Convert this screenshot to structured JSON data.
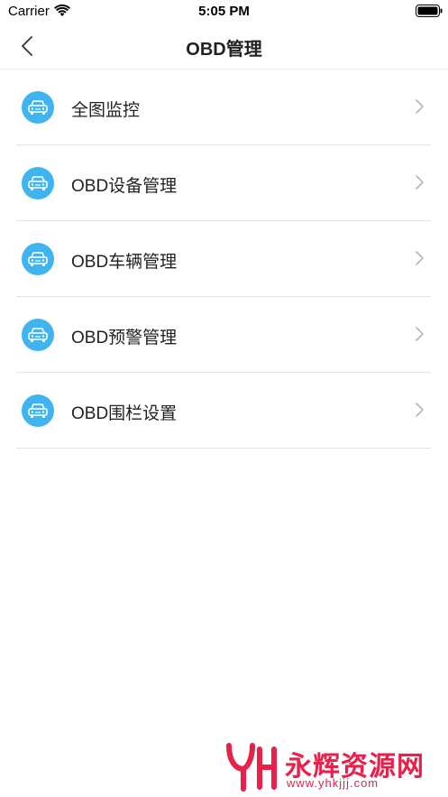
{
  "status_bar": {
    "carrier": "Carrier",
    "time": "5:05 PM",
    "icons": [
      "wifi-icon",
      "battery-icon"
    ]
  },
  "nav": {
    "title": "OBD管理",
    "back_icon": "chevron-left-icon"
  },
  "menu": {
    "icon": "car-icon",
    "icon_color": "#3fb4f0",
    "items": [
      {
        "label": "全图监控"
      },
      {
        "label": "OBD设备管理"
      },
      {
        "label": "OBD车辆管理"
      },
      {
        "label": "OBD预警管理"
      },
      {
        "label": "OBD围栏设置"
      }
    ]
  },
  "watermark": {
    "name": "永辉资源网",
    "url": "www.yhkjjj.com",
    "color": "#e8214b"
  }
}
